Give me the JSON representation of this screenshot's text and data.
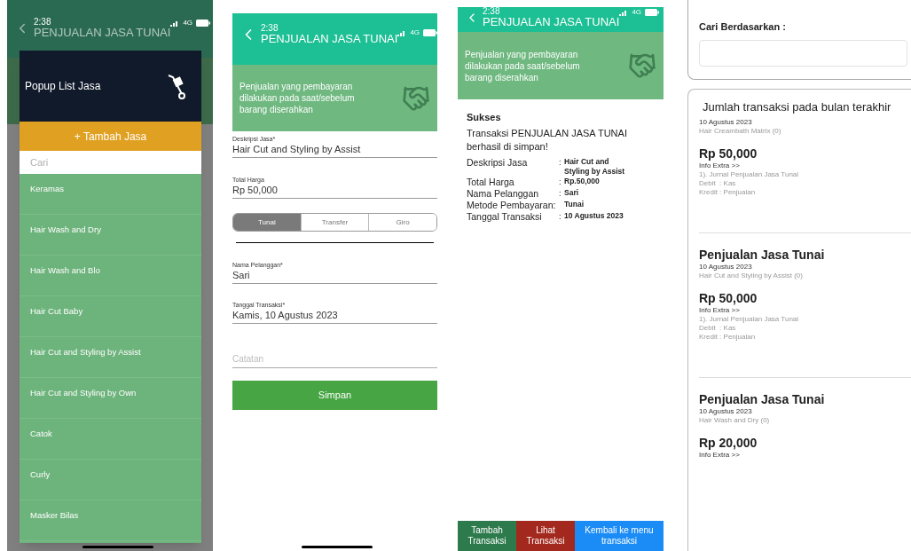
{
  "popup_screen": {
    "status_time": "2:38",
    "network": "4G",
    "header_title": "PENJUALAN JASA TUNAI",
    "popup": {
      "title": "Popup List Jasa",
      "add_button": "+ Tambah Jasa",
      "search": {
        "placeholder": "Cari"
      },
      "items": [
        "Keramas",
        "Hair Wash and Dry",
        "Hair Wash and Blo",
        "Hair Cut Baby",
        "Hair Cut and Styling by Assist",
        "Hair Cut and Styling by Own",
        "Catok",
        "Curly",
        "Masker Bilas"
      ]
    }
  },
  "form_screen": {
    "status_time": "2:38",
    "network": "4G",
    "header_title": "PENJUALAN JASA TUNAI",
    "banner": "Penjualan yang pembayaran dilakukan pada saat/sebelum barang diserahkan",
    "fields_top": [
      {
        "label": "Deskripsi Jasa*",
        "value": "Hair Cut and Styling by Assist"
      },
      {
        "label": "Total Harga",
        "value": "Rp 50,000"
      }
    ],
    "payment_tabs": [
      {
        "label": "Tunai",
        "selected": true
      },
      {
        "label": "Transfer",
        "selected": false
      },
      {
        "label": "Giro",
        "selected": false
      }
    ],
    "fields_bottom": [
      {
        "label": "Nama Pelanggan*",
        "value": "Sari"
      },
      {
        "label": "Tanggal Transaksi*",
        "value": "Kamis, 10 Agustus 2023"
      }
    ],
    "notes": {
      "placeholder": "Catatan"
    },
    "save_button": "Simpan"
  },
  "success_screen": {
    "status_time": "2:38",
    "network": "4G",
    "header_title": "PENJUALAN JASA TUNAI",
    "banner": "Penjualan yang pembayaran dilakukan pada saat/sebelum barang diserahkan",
    "heading": "Sukses",
    "message": "Transaksi PENJUALAN JASA TUNAI berhasil di simpan!",
    "details": [
      {
        "label": "Deskripsi Jasa",
        "separator": ":",
        "value": "Hair Cut and Styling by Assist"
      },
      {
        "label": "Total Harga",
        "separator": ":",
        "value": "Rp.50,000"
      },
      {
        "label": "Nama Pelanggan",
        "separator": ":",
        "value": "Sari"
      },
      {
        "label": "Metode Pembayaran:",
        "value": "Tunai"
      },
      {
        "label": "Tanggal Transaksi",
        "separator": ":",
        "value": "10 Agustus 2023"
      }
    ],
    "buttons": [
      {
        "label": "Tambah Transaksi",
        "color": "#2d7a4c"
      },
      {
        "label": "Lihat Transaksi",
        "color": "#a3281d"
      },
      {
        "label": "Kembali ke menu transaksi",
        "color": "#1b8cf5"
      }
    ]
  },
  "history_screen": {
    "search_label": "Cari Berdasarkan :",
    "list_title": "Jumlah transaksi pada bulan terakhir",
    "items": [
      {
        "date": "10 Agustus 2023",
        "service": "Hair Creambath Matrix (0)",
        "price": "Rp 50,000",
        "info_link": "Info Extra >>",
        "journal": [
          "1). Jurnal Penjualan Jasa Tunai",
          "Debit  : Kas",
          "Kredit : Penjualan"
        ]
      },
      {
        "title": "Penjualan Jasa Tunai",
        "date": "10 Agustus 2023",
        "service": "Hair Cut and Styling by Assist (0)",
        "price": "Rp 50,000",
        "info_link": "Info Extra >>",
        "journal": [
          "1). Jurnal Penjualan Jasa Tunai",
          "Debit  : Kas",
          "Kredit : Penjualan"
        ]
      },
      {
        "title": "Penjualan Jasa Tunai",
        "date": "10 Agustus 2023",
        "service": "Hair Wash and Dry (0)",
        "price": "Rp 20,000",
        "info_link": "Info Extra >>"
      }
    ]
  }
}
